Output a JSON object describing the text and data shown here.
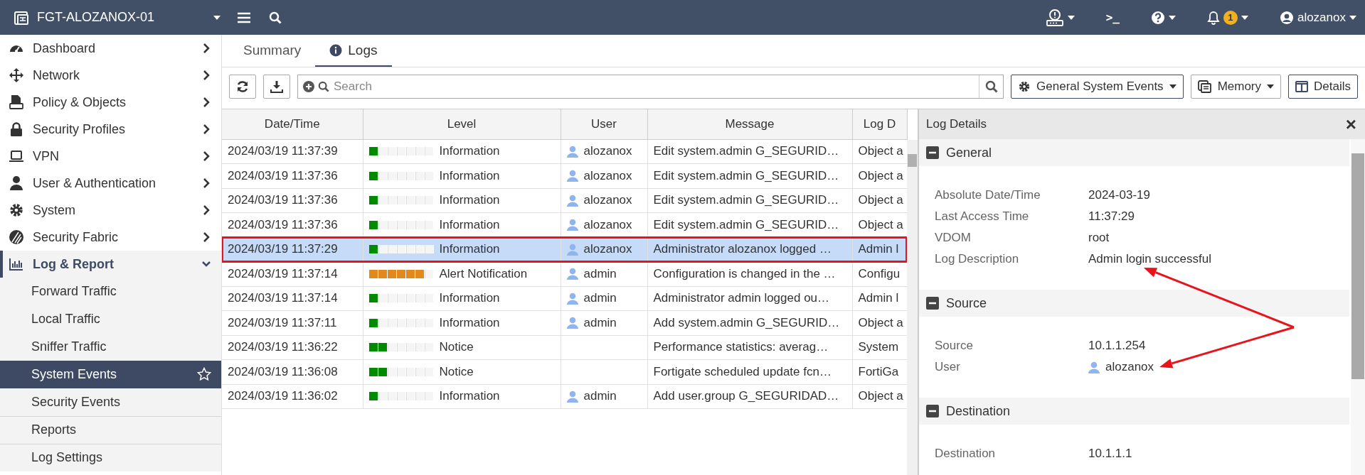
{
  "topbar": {
    "hostname": "FGT-ALOZANOX-01",
    "terminal_glyph": ">_",
    "notification_count": "1",
    "username": "alozanox"
  },
  "sidebar": {
    "items": [
      {
        "label": "Dashboard",
        "expanded": false
      },
      {
        "label": "Network",
        "expanded": false
      },
      {
        "label": "Policy & Objects",
        "expanded": false
      },
      {
        "label": "Security Profiles",
        "expanded": false
      },
      {
        "label": "VPN",
        "expanded": false
      },
      {
        "label": "User & Authentication",
        "expanded": false
      },
      {
        "label": "System",
        "expanded": false
      },
      {
        "label": "Security Fabric",
        "expanded": false
      },
      {
        "label": "Log & Report",
        "expanded": true,
        "children": [
          {
            "label": "Forward Traffic",
            "selected": false
          },
          {
            "label": "Local Traffic",
            "selected": false
          },
          {
            "label": "Sniffer Traffic",
            "selected": false
          },
          {
            "label": "System Events",
            "selected": true
          },
          {
            "label": "Security Events",
            "selected": false
          },
          {
            "label": "Reports",
            "selected": false
          },
          {
            "label": "Log Settings",
            "selected": false
          }
        ]
      }
    ]
  },
  "tabs": [
    {
      "label": "Summary",
      "selected": false
    },
    {
      "label": "Logs",
      "selected": true
    }
  ],
  "toolbar": {
    "search": {
      "placeholder": "Search"
    },
    "filter_dropdown": "General System Events",
    "source_dropdown": "Memory",
    "details_button": "Details"
  },
  "table": {
    "columns": [
      "Date/Time",
      "Level",
      "User",
      "Message",
      "Log D"
    ],
    "rows": [
      {
        "datetime": "2024/03/19 11:37:39",
        "level": 0.143,
        "color": "#008a00",
        "level_label": "Information",
        "user": "alozanox",
        "message": "Edit system.admin G_SEGURID…",
        "column_5": "Object a",
        "selected": false,
        "annotated": false
      },
      {
        "datetime": "2024/03/19 11:37:36",
        "level": 0.143,
        "color": "#008a00",
        "level_label": "Information",
        "user": "alozanox",
        "message": "Edit system.admin G_SEGURID…",
        "column_5": "Object a",
        "selected": false,
        "annotated": false
      },
      {
        "datetime": "2024/03/19 11:37:36",
        "level": 0.143,
        "color": "#008a00",
        "level_label": "Information",
        "user": "alozanox",
        "message": "Edit system.admin G_SEGURID…",
        "column_5": "Object a",
        "selected": false,
        "annotated": false
      },
      {
        "datetime": "2024/03/19 11:37:36",
        "level": 0.143,
        "color": "#008a00",
        "level_label": "Information",
        "user": "alozanox",
        "message": "Edit system.admin G_SEGURID…",
        "column_5": "Object a",
        "selected": false,
        "annotated": false
      },
      {
        "datetime": "2024/03/19 11:37:29",
        "level": 0.143,
        "color": "#008a00",
        "level_label": "Information",
        "user": "alozanox",
        "message": "Administrator alozanox logged …",
        "column_5": "Admin l",
        "selected": true,
        "annotated": true
      },
      {
        "datetime": "2024/03/19 11:37:14",
        "level": 0.857,
        "color": "#e08a1e",
        "level_label": "Alert Notification",
        "user": "admin",
        "message": "Configuration is changed in the …",
        "column_5": "Configu",
        "selected": false,
        "annotated": false
      },
      {
        "datetime": "2024/03/19 11:37:14",
        "level": 0.143,
        "color": "#008a00",
        "level_label": "Information",
        "user": "admin",
        "message": "Administrator admin logged ou…",
        "column_5": "Admin l",
        "selected": false,
        "annotated": false
      },
      {
        "datetime": "2024/03/19 11:37:11",
        "level": 0.143,
        "color": "#008a00",
        "level_label": "Information",
        "user": "admin",
        "message": "Add system.admin G_SEGURID…",
        "column_5": "Object a",
        "selected": false,
        "annotated": false
      },
      {
        "datetime": "2024/03/19 11:36:22",
        "level": 0.286,
        "color": "#008a00",
        "level_label": "Notice",
        "message": "Performance statistics: averag…",
        "column_5": "System",
        "selected": false,
        "annotated": false
      },
      {
        "datetime": "2024/03/19 11:36:08",
        "level": 0.286,
        "color": "#008a00",
        "level_label": "Notice",
        "message": "Fortigate scheduled update fcn…",
        "column_5": "FortiGa",
        "selected": false,
        "annotated": false
      },
      {
        "datetime": "2024/03/19 11:36:02",
        "level": 0.143,
        "color": "#008a00",
        "level_label": "Information",
        "user": "admin",
        "message": "Add user.group G_SEGURIDAD…",
        "column_5": "Object a",
        "selected": false,
        "annotated": false
      }
    ]
  },
  "details": {
    "title": "Log Details",
    "close_glyph": "×",
    "sections": [
      {
        "title": "General",
        "expanded": true,
        "fields": [
          {
            "label": "Absolute Date/Time",
            "value": "2024-03-19",
            "kind": "text",
            "annotated": false
          },
          {
            "label": "Last Access Time",
            "value": "11:37:29",
            "kind": "text",
            "annotated": false
          },
          {
            "label": "VDOM",
            "value": "root",
            "kind": "text",
            "annotated": false
          },
          {
            "label": "Log Description",
            "value": "Admin login successful",
            "kind": "text",
            "annotated": true
          }
        ]
      },
      {
        "title": "Source",
        "expanded": true,
        "fields": [
          {
            "label": "Source",
            "value": "10.1.1.254",
            "kind": "text",
            "annotated": false
          },
          {
            "label": "User",
            "value": "alozanox",
            "kind": "user",
            "annotated": true
          }
        ]
      },
      {
        "title": "Destination",
        "expanded": true,
        "fields": [
          {
            "label": "Destination",
            "value": "10.1.1.1",
            "kind": "text",
            "annotated": false
          }
        ]
      }
    ]
  }
}
